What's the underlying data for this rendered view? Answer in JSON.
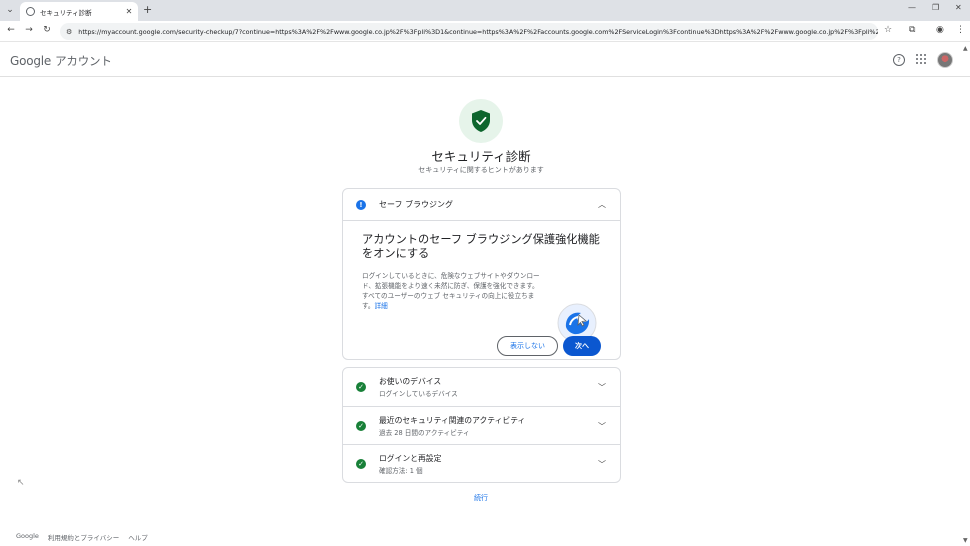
{
  "browser": {
    "tab_title": "セキュリティ診断",
    "url": "https://myaccount.google.com/security-checkup/7?continue=https%3A%2F%2Fwww.google.co.jp%2F%3Fpli%3D1&continue=https%3A%2F%2Faccounts.google.com%2FServiceLogin%3Fcontinue%3Dhttps%3A%2F%2Fwww.google.co.jp%2F%3Fpli%253D..."
  },
  "app": {
    "logo_google": "Google",
    "logo_account": "アカウント"
  },
  "hero": {
    "title": "セキュリティ診断",
    "subtitle": "セキュリティに関するヒントがあります"
  },
  "safe_browsing": {
    "header": "セーフ ブラウジング",
    "title": "アカウントのセーフ ブラウジング保護強化機能をオンにする",
    "description": "ログインしているときに、危険なウェブサイトやダウンロード、拡張機能をより速く未然に防ぎ、保護を強化できます。すべてのユーザーのウェブ セキュリティの向上に役立ちます。",
    "learn_more": "詳細",
    "dismiss_label": "表示しない",
    "next_label": "次へ"
  },
  "items": [
    {
      "title": "お使いのデバイス",
      "subtitle": "ログインしているデバイス"
    },
    {
      "title": "最近のセキュリティ関連のアクティビティ",
      "subtitle": "過去 28 日間のアクティビティ"
    },
    {
      "title": "ログインと再設定",
      "subtitle": "確認方法: 1 個"
    }
  ],
  "continue_label": "続行",
  "footer": {
    "google": "Google",
    "terms": "利用規約とプライバシー",
    "help": "ヘルプ"
  },
  "colors": {
    "accent_blue": "#1a73e8",
    "button_blue": "#0b57d0",
    "success_green": "#188038"
  }
}
